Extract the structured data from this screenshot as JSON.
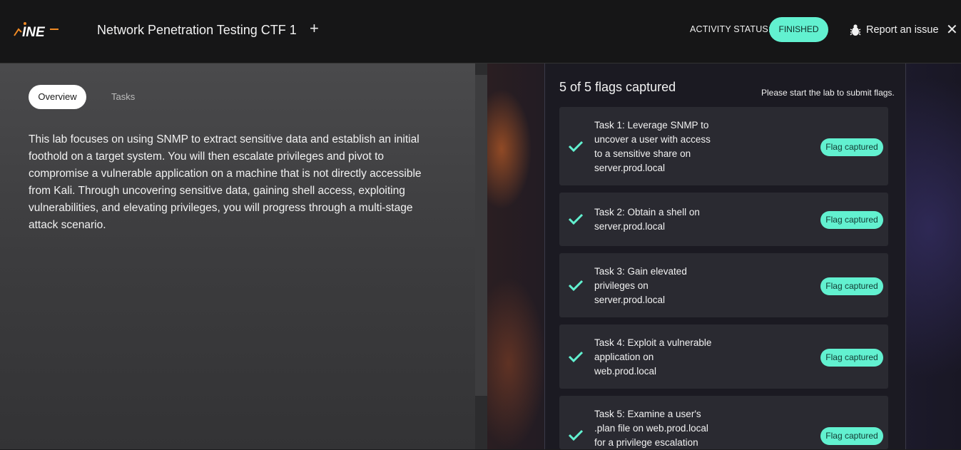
{
  "header": {
    "logo_text": "INE",
    "title": "Network Penetration Testing CTF 1",
    "add_label": "+",
    "status_label": "ACTIVITY STATUS:",
    "status_value": "FINISHED",
    "report_label": "Report an issue",
    "close_label": "✕"
  },
  "tabs": {
    "overview": "Overview",
    "tasks": "Tasks"
  },
  "overview_text": "This lab focuses on using SNMP to extract sensitive data and establish an initial foothold on a target system. You will then escalate privileges and pivot to compromise a vulnerable application on a machine that is not directly accessible from Kali. Through uncovering sensitive data, gaining shell access, exploiting vulnerabilities, and elevating privileges, you will progress through a multi-stage attack scenario.",
  "flags": {
    "count_label": "5 of 5 flags captured",
    "note": "Please start the lab to submit flags.",
    "tasks": [
      {
        "text": "Task 1: Leverage SNMP to uncover a user with access to a sensitive share on server.prod.local",
        "badge": "Flag captured"
      },
      {
        "text": "Task 2: Obtain a shell on server.prod.local",
        "badge": "Flag captured"
      },
      {
        "text": "Task 3: Gain elevated privileges on server.prod.local",
        "badge": "Flag captured"
      },
      {
        "text": "Task 4: Exploit a vulnerable application on web.prod.local",
        "badge": "Flag captured"
      },
      {
        "text": "Task 5: Examine a user's .plan file on web.prod.local for a privilege escalation",
        "badge": "Flag captured"
      }
    ]
  },
  "colors": {
    "accent": "#62f1d0",
    "logo_orange": "#f08a24"
  },
  "icons": {
    "bug": "bug-icon",
    "check": "check-icon",
    "close": "close-icon",
    "plus": "plus-icon"
  }
}
